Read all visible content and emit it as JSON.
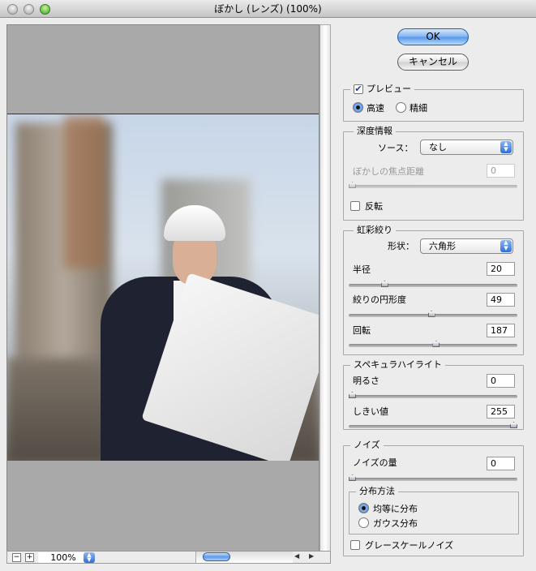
{
  "window": {
    "title": "ぼかし (レンズ) (100%)"
  },
  "preview_bar": {
    "zoom_out": "−",
    "zoom_in": "+",
    "zoom_value": "100%"
  },
  "buttons": {
    "ok": "OK",
    "cancel": "キャンセル"
  },
  "preview_group": {
    "label": "プレビュー",
    "checked": true,
    "fast": "高速",
    "accurate": "精細",
    "selected": "fast"
  },
  "depth": {
    "label": "深度情報",
    "source_label": "ソース：",
    "source_value": "なし",
    "focal_label": "ぼかしの焦点距離",
    "focal_value": "0",
    "invert_label": "反転"
  },
  "iris": {
    "label": "虹彩絞り",
    "shape_label": "形状：",
    "shape_value": "六角形",
    "radius_label": "半径",
    "radius_value": "20",
    "radius_fraction": 0.2,
    "curvature_label": "絞りの円形度",
    "curvature_value": "49",
    "curvature_fraction": 0.49,
    "rotation_label": "回転",
    "rotation_value": "187",
    "rotation_fraction": 0.52
  },
  "specular": {
    "label": "スペキュラハイライト",
    "brightness_label": "明るさ",
    "brightness_value": "0",
    "brightness_fraction": 0,
    "threshold_label": "しきい値",
    "threshold_value": "255",
    "threshold_fraction": 1
  },
  "noise": {
    "label": "ノイズ",
    "amount_label": "ノイズの量",
    "amount_value": "0",
    "amount_fraction": 0,
    "distribution_label": "分布方法",
    "uniform": "均等に分布",
    "gaussian": "ガウス分布",
    "selected": "uniform",
    "mono_label": "グレースケールノイズ"
  }
}
